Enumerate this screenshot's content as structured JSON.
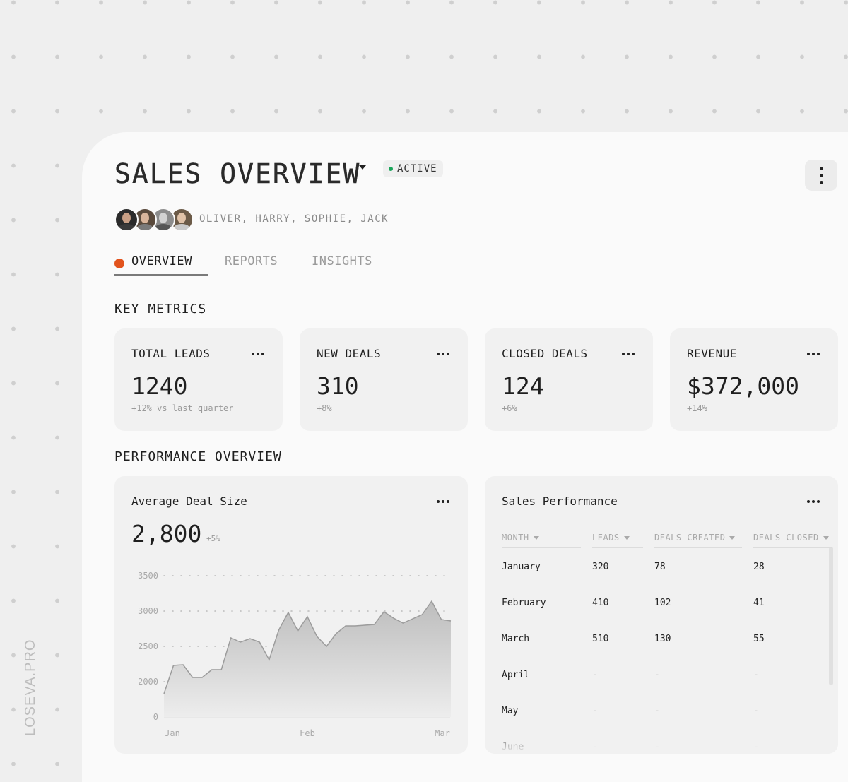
{
  "watermark": "LOSEVA.PRO",
  "header": {
    "title": "SALES OVERVIEW",
    "status": "ACTIVE",
    "team": "OLIVER, HARRY, SOPHIE, JACK"
  },
  "avatars": [
    {
      "name": "Oliver",
      "hair": "#2b2b2b",
      "skin": "#c99f85",
      "shirt": "#3a3a3a"
    },
    {
      "name": "Harry",
      "hair": "#5a4a3c",
      "skin": "#d9b59b",
      "shirt": "#7a7a7a"
    },
    {
      "name": "Sophie",
      "hair": "#8c8c8c",
      "skin": "#d2d2d2",
      "shirt": "#555555"
    },
    {
      "name": "Jack",
      "hair": "#6b5a47",
      "skin": "#e0c2a8",
      "shirt": "#c9c9c9"
    }
  ],
  "tabs": [
    {
      "label": "OVERVIEW",
      "active": true
    },
    {
      "label": "REPORTS",
      "active": false
    },
    {
      "label": "INSIGHTS",
      "active": false
    }
  ],
  "key_metrics": {
    "heading": "KEY METRICS",
    "cards": [
      {
        "label": "TOTAL LEADS",
        "value": "1240",
        "sub": "+12% vs last quarter"
      },
      {
        "label": "NEW DEALS",
        "value": "310",
        "sub": "+8%"
      },
      {
        "label": "CLOSED DEALS",
        "value": "124",
        "sub": "+6%"
      },
      {
        "label": "REVENUE",
        "value": "$372,000",
        "sub": "+14%"
      }
    ]
  },
  "performance": {
    "heading": "PERFORMANCE OVERVIEW",
    "avg_deal": {
      "title": "Average Deal Size",
      "value": "2,800",
      "delta": "+5%"
    },
    "sales_table": {
      "title": "Sales Performance",
      "columns": [
        "MONTH",
        "LEADS",
        "DEALS CREATED",
        "DEALS CLOSED"
      ],
      "rows": [
        [
          "January",
          "320",
          "78",
          "28"
        ],
        [
          "February",
          "410",
          "102",
          "41"
        ],
        [
          "March",
          "510",
          "130",
          "55"
        ],
        [
          "April",
          "-",
          "-",
          "-"
        ],
        [
          "May",
          "-",
          "-",
          "-"
        ],
        [
          "June",
          "-",
          "-",
          "-"
        ]
      ]
    }
  },
  "colors": {
    "accent": "#e2531d",
    "status": "#1aa55a",
    "chart_fill": "#bdbdbd"
  },
  "chart_data": {
    "type": "area",
    "title": "Average Deal Size",
    "y_ticks": [
      "3500",
      "3000",
      "2500",
      "2000",
      "0"
    ],
    "x_ticks": [
      "Jan",
      "Feb",
      "Mar"
    ],
    "x": [
      0,
      3,
      5,
      7,
      9,
      10.5,
      12,
      13.5,
      15,
      17,
      19,
      21,
      22.5,
      24,
      26,
      28,
      30,
      32,
      34,
      36,
      38,
      40,
      42,
      44,
      45,
      47,
      49,
      50,
      52,
      54,
      56,
      58,
      60,
      62,
      64,
      65,
      66,
      67
    ],
    "values": [
      1830,
      2230,
      2240,
      2060,
      2060,
      2170,
      2170,
      2620,
      2560,
      2610,
      2560,
      2310,
      2730,
      2980,
      2720,
      2920,
      2640,
      2500,
      2680,
      2790,
      2790,
      2800,
      2810,
      2990,
      2900,
      2830,
      2890,
      2950,
      3140,
      2880,
      2860
    ]
  }
}
